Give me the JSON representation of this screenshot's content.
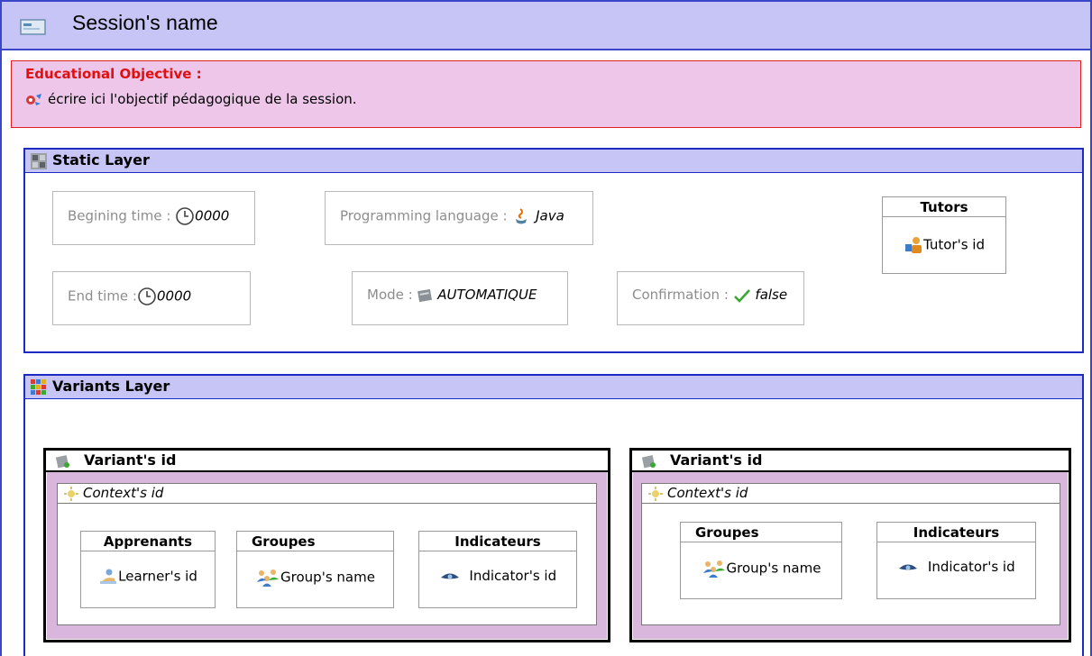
{
  "session": {
    "title": "Session's name"
  },
  "objective": {
    "title": "Educational Objective :",
    "text": "écrire ici l'objectif pédagogique de la session."
  },
  "static_layer": {
    "title": "Static Layer",
    "begin_time": {
      "label": "Begining time : ",
      "value": "0000"
    },
    "end_time": {
      "label": "End time :",
      "value": "0000"
    },
    "programming_language": {
      "label": "Programming language : ",
      "value": "Java"
    },
    "mode": {
      "label": "Mode : ",
      "value": "AUTOMATIQUE"
    },
    "confirmation": {
      "label": "Confirmation : ",
      "value": "false"
    },
    "tutors": {
      "title": "Tutors",
      "item": "Tutor's id"
    }
  },
  "variants_layer": {
    "title": "Variants Layer",
    "variants": [
      {
        "title": "Variant's id",
        "context": "Context's id",
        "boxes": [
          {
            "title": "Apprenants",
            "item": "Learner's id"
          },
          {
            "title": "Groupes",
            "item": "Group's name"
          },
          {
            "title": "Indicateurs",
            "item": "Indicator's id"
          }
        ]
      },
      {
        "title": "Variant's id",
        "context": "Context's id",
        "boxes": [
          {
            "title": "Groupes",
            "item": "Group's name"
          },
          {
            "title": "Indicateurs",
            "item": "Indicator's id"
          }
        ]
      }
    ]
  },
  "icons": {
    "session": "session-icon",
    "objective": "objective-icon",
    "clock": "clock-icon",
    "java": "java-icon",
    "mode": "mode-icon",
    "check": "check-icon",
    "tutor": "tutor-icon",
    "learner": "learner-icon",
    "group": "group-icon",
    "indicator": "eye-icon"
  },
  "colors": {
    "header_bg": "#c7c5f5",
    "frame_blue": "#1d2bc3",
    "objective_bg": "#edc6ea",
    "objective_border": "#e02020",
    "variant_bg": "#d9b6dc"
  }
}
